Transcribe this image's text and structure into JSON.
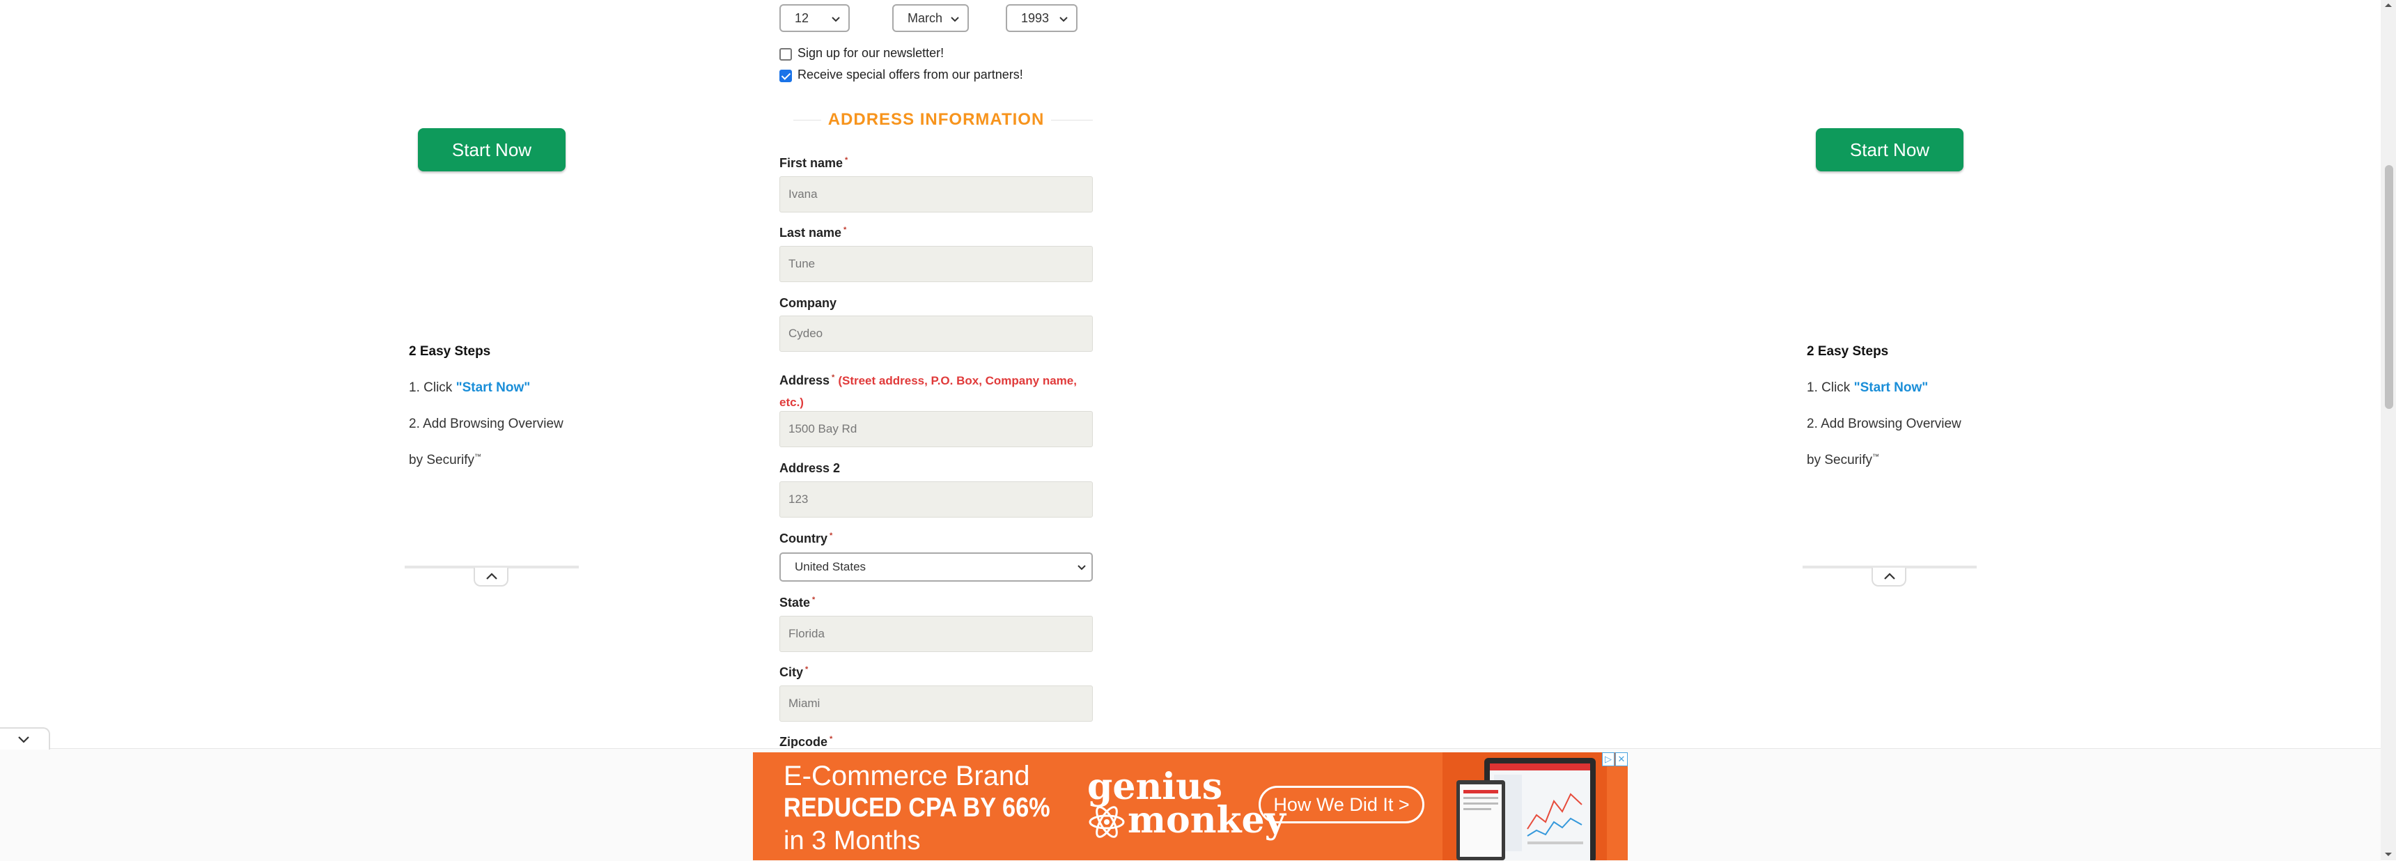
{
  "birth": {
    "day": "12",
    "month": "March",
    "year": "1993"
  },
  "checkboxes": [
    {
      "label": "Sign up for our newsletter!",
      "checked": false
    },
    {
      "label": "Receive special offers from our partners!",
      "checked": true
    }
  ],
  "address_section": {
    "title": "ADDRESS INFORMATION",
    "first_name": {
      "label": "First name",
      "value": "Ivana"
    },
    "last_name": {
      "label": "Last name",
      "value": "Tune"
    },
    "company": {
      "label": "Company",
      "value": "Cydeo"
    },
    "address": {
      "label": "Address",
      "note": "(Street address, P.O. Box, Company name, etc.)",
      "value": "1500 Bay Rd"
    },
    "address2": {
      "label": "Address 2",
      "value": "123"
    },
    "country": {
      "label": "Country",
      "value": "United States"
    },
    "state": {
      "label": "State",
      "value": "Florida"
    },
    "city": {
      "label": "City",
      "value": "Miami"
    },
    "zipcode": {
      "label": "Zipcode"
    },
    "required_mark": "*"
  },
  "side_ads": {
    "button_label": "Start Now",
    "steps_title": "2 Easy Steps",
    "step1_prefix": "1. Click ",
    "step1_link": "\"Start Now\"",
    "step2_line1": "2. Add Browsing Overview",
    "step2_line2": "by Securify",
    "trademark": "™"
  },
  "banner_ad": {
    "line1": "E-Commerce Brand",
    "line2": "REDUCED CPA BY 66%",
    "line3": "in 3 Months",
    "brand_top": "genius",
    "brand_bottom": "monkey",
    "cta": "How We Did It >",
    "ad_choices": "▷",
    "close": "✕"
  },
  "colors": {
    "accent": "#f7941d",
    "button": "#0e9a5b",
    "link": "#1a8ed8",
    "ad_bg": "#f26c2a",
    "required_note": "#e03a3a"
  }
}
